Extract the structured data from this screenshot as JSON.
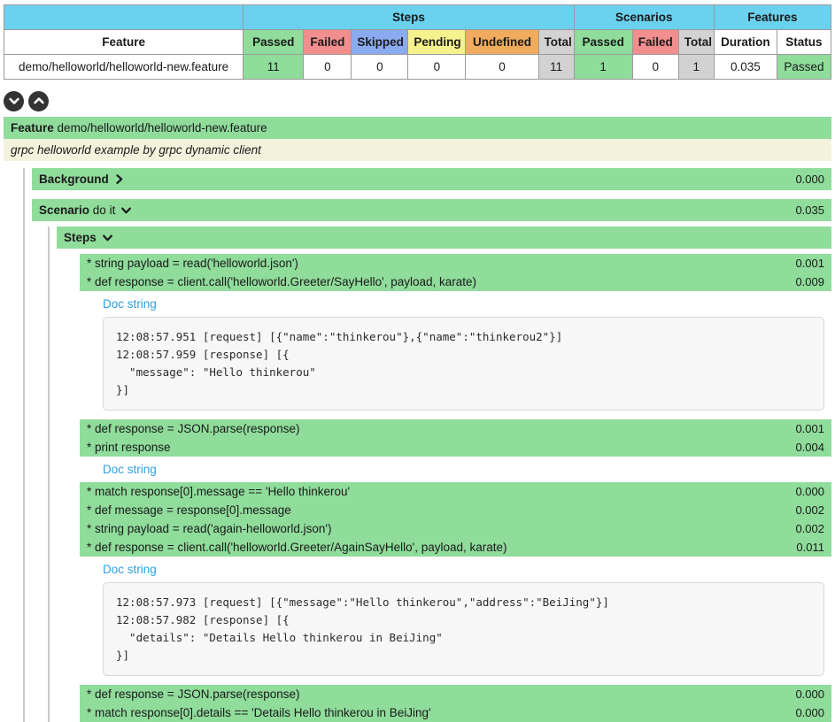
{
  "summary_table": {
    "group_headers": [
      {
        "label": "",
        "style": "blank"
      },
      {
        "label": "Steps",
        "span": 6,
        "style": "group"
      },
      {
        "label": "Scenarios",
        "span": 3,
        "style": "group"
      },
      {
        "label": "Features",
        "span": 2,
        "style": "group"
      }
    ],
    "column_headers": [
      {
        "label": "Feature",
        "style": "feature"
      },
      {
        "label": "Passed",
        "style": "passed"
      },
      {
        "label": "Failed",
        "style": "failed"
      },
      {
        "label": "Skipped",
        "style": "skipped"
      },
      {
        "label": "Pending",
        "style": "pending"
      },
      {
        "label": "Undefined",
        "style": "undefined"
      },
      {
        "label": "Total",
        "style": "total"
      },
      {
        "label": "Passed",
        "style": "passed"
      },
      {
        "label": "Failed",
        "style": "failed"
      },
      {
        "label": "Total",
        "style": "total"
      },
      {
        "label": "Duration",
        "style": "plain"
      },
      {
        "label": "Status",
        "style": "plain"
      }
    ],
    "rows": [
      {
        "feature": "demo/helloworld/helloworld-new.feature",
        "steps_passed": "11",
        "steps_failed": "0",
        "steps_skipped": "0",
        "steps_pending": "0",
        "steps_undefined": "0",
        "steps_total": "11",
        "scenarios_passed": "1",
        "scenarios_failed": "0",
        "scenarios_total": "1",
        "duration": "0.035",
        "status": "Passed"
      }
    ]
  },
  "controls": {
    "expand_all": "expand-all-icon",
    "collapse_all": "collapse-all-icon"
  },
  "feature": {
    "keyword": "Feature",
    "name": "demo/helloworld/helloworld-new.feature",
    "description": "grpc helloworld example by grpc dynamic client"
  },
  "background": {
    "keyword": "Background",
    "chevron": "chevron-right-icon",
    "duration": "0.000"
  },
  "scenario": {
    "keyword": "Scenario",
    "name": "do it",
    "chevron": "chevron-down-icon",
    "duration": "0.035"
  },
  "steps_section": {
    "label": "Steps",
    "chevron": "chevron-down-icon"
  },
  "docstring_label": "Doc string",
  "step_groups": [
    {
      "steps": [
        {
          "text": "* string payload = read('helloworld.json')",
          "duration": "0.001"
        },
        {
          "text": "* def response = client.call('helloworld.Greeter/SayHello', payload, karate)",
          "duration": "0.009"
        }
      ],
      "docstring": "12:08:57.951 [request] [{\"name\":\"thinkerou\"},{\"name\":\"thinkerou2\"}]\n12:08:57.959 [response] [{\n  \"message\": \"Hello thinkerou\"\n}]"
    },
    {
      "steps": [
        {
          "text": "* def response = JSON.parse(response)",
          "duration": "0.001"
        },
        {
          "text": "* print response",
          "duration": "0.004"
        }
      ],
      "docstring": null
    },
    {
      "steps": [
        {
          "text": "* match response[0].message == 'Hello thinkerou'",
          "duration": "0.000"
        },
        {
          "text": "* def message = response[0].message",
          "duration": "0.002"
        },
        {
          "text": "* string payload = read('again-helloworld.json')",
          "duration": "0.002"
        },
        {
          "text": "* def response = client.call('helloworld.Greeter/AgainSayHello', payload, karate)",
          "duration": "0.011"
        }
      ],
      "docstring": "12:08:57.973 [request] [{\"message\":\"Hello thinkerou\",\"address\":\"BeiJing\"}]\n12:08:57.982 [response] [{\n  \"details\": \"Details Hello thinkerou in BeiJing\"\n}]"
    },
    {
      "steps": [
        {
          "text": "* def response = JSON.parse(response)",
          "duration": "0.000"
        },
        {
          "text": "* match response[0].details == 'Details Hello thinkerou in BeiJing'",
          "duration": "0.000"
        }
      ],
      "docstring": null
    }
  ],
  "colors": {
    "group_header": "#6ad1ef",
    "passed": "#8fdc9b",
    "failed": "#f18e8e",
    "skipped": "#8babf0",
    "pending": "#f5f18c",
    "undefined": "#f0ab5e",
    "total": "#d2d2d2",
    "description_bg": "#f3f3dd",
    "link": "#2c9fe0"
  }
}
